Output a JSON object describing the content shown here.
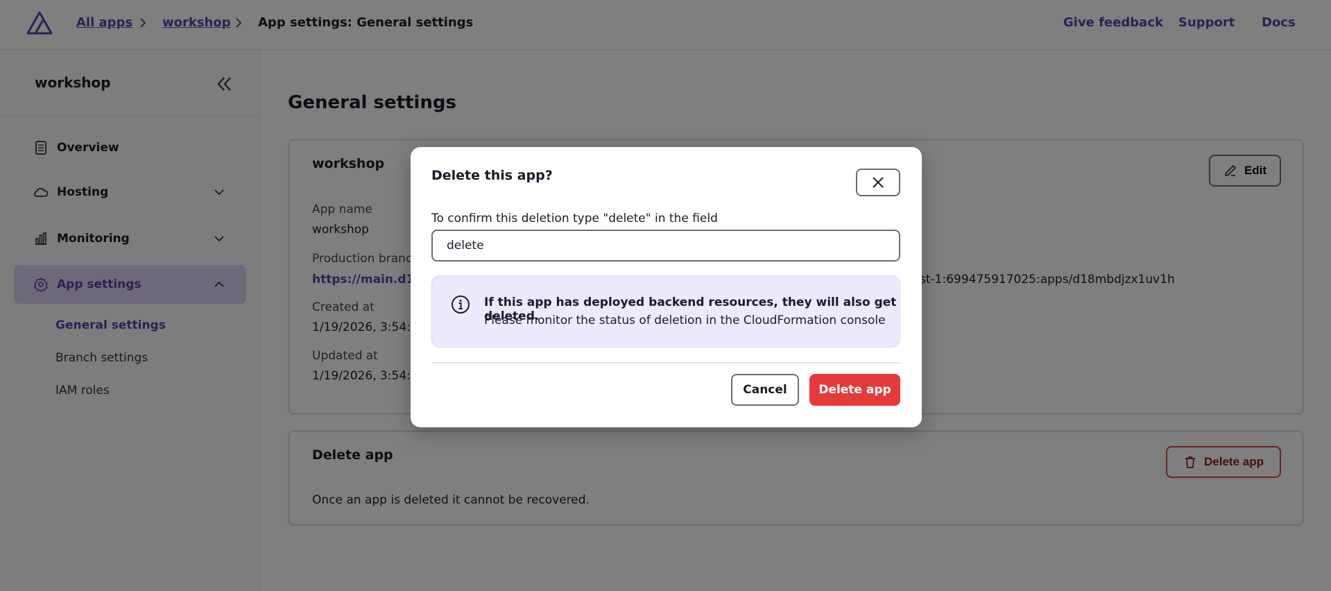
{
  "header": {
    "logo_icon": "amplify-logo-icon",
    "breadcrumbs": [
      {
        "label": "All apps"
      },
      {
        "label": "workshop"
      },
      {
        "label": "App settings: General settings"
      }
    ],
    "links": [
      "Give feedback",
      "Support",
      "Docs"
    ]
  },
  "sidebar": {
    "title": "workshop",
    "collapse_icon": "double-chevron-left-icon",
    "items": [
      {
        "label": "Overview",
        "icon": "document-icon"
      },
      {
        "label": "Hosting",
        "icon": "cloud-icon"
      },
      {
        "label": "Monitoring",
        "icon": "bar-chart-icon"
      },
      {
        "label": "App settings",
        "icon": "gear-icon"
      }
    ],
    "subitems": [
      "General settings",
      "Branch settings",
      "IAM roles"
    ]
  },
  "main": {
    "title": "General settings",
    "details_card": {
      "title": "workshop",
      "edit_label": "Edit",
      "app_name_label": "App name",
      "app_name_value": "workshop",
      "production_branch_label": "Production branch",
      "production_branch_value": "https://main.d18",
      "arn_fragment": "st-1:699475917025:apps/d18mbdjzx1uv1h",
      "created_label": "Created at",
      "created_value": "1/19/2026, 3:54:4",
      "updated_label": "Updated at",
      "updated_value": "1/19/2026, 3:54:4"
    },
    "delete_card": {
      "title": "Delete app",
      "button_label": "Delete app",
      "description": "Once an app is deleted it cannot be recovered."
    }
  },
  "modal": {
    "title": "Delete this app?",
    "confirm_label": "To confirm this deletion type \"delete\" in the field",
    "input_value": "delete",
    "alert_bold": "If this app has deployed backend resources, they will also get deleted.",
    "alert_text": "Please monitor the status of deletion in the CloudFormation console",
    "cancel_label": "Cancel",
    "delete_label": "Delete app"
  },
  "colors": {
    "accent": "#5d3fa8",
    "danger": "#e53a3a",
    "alert_bg": "#eeeafd",
    "active_nav_bg": "#ddd3f5"
  }
}
